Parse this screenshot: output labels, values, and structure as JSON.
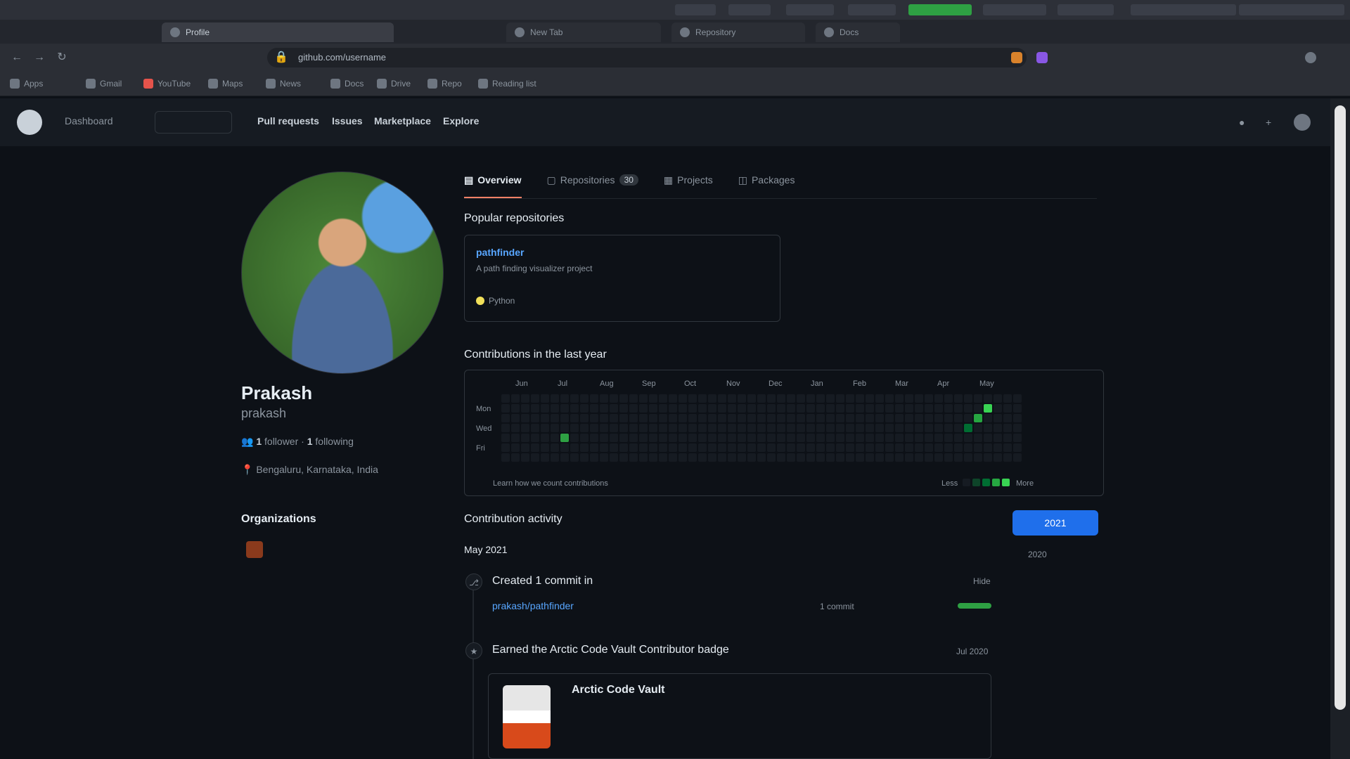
{
  "browser": {
    "tabs": [
      {
        "label": "Profile",
        "active": true
      },
      {
        "label": "New Tab",
        "active": false
      },
      {
        "label": "Repository",
        "active": false
      },
      {
        "label": "Docs",
        "active": false
      }
    ],
    "url": "github.com/username",
    "bookmarks": [
      "Apps",
      "Gmail",
      "YouTube",
      "Maps",
      "News",
      "Docs",
      "Drive",
      "Repo",
      "Reading list"
    ]
  },
  "header": {
    "user_label": "Dashboard",
    "nav": [
      "Pull requests",
      "Issues",
      "Marketplace",
      "Explore"
    ]
  },
  "profile": {
    "name": "Prakash",
    "login": "prakash",
    "followers_count": "1",
    "followers_label": "follower",
    "following_count": "1",
    "following_label": "following",
    "location": "Bengaluru, Karnataka, India",
    "organizations_title": "Organizations"
  },
  "tabs": [
    {
      "label": "Overview",
      "count": null,
      "active": true
    },
    {
      "label": "Repositories",
      "count": "30",
      "active": false
    },
    {
      "label": "Projects",
      "count": null,
      "active": false
    },
    {
      "label": "Packages",
      "count": null,
      "active": false
    }
  ],
  "pinned": {
    "title": "Popular repositories",
    "repo_name": "pathfinder",
    "repo_desc": "A path finding visualizer project",
    "language": "Python"
  },
  "contributions": {
    "title": "Contributions in the last year",
    "months": [
      "Jun",
      "Jul",
      "Aug",
      "Sep",
      "Oct",
      "Nov",
      "Dec",
      "Jan",
      "Feb",
      "Mar",
      "Apr",
      "May"
    ],
    "day_labels": [
      "Mon",
      "Wed",
      "Fri"
    ],
    "learn_link": "Learn how we count contributions",
    "less_label": "Less",
    "more_label": "More"
  },
  "activity": {
    "title": "Contribution activity",
    "year_button": "2021",
    "year_other": "2020",
    "month": "May 2021",
    "item1_text": "Created 1 commit in",
    "item1_repo": "prakash/pathfinder",
    "item1_commits": "1 commit",
    "item1_toggle": "Hide",
    "item2_text": "Earned the Arctic Code Vault Contributor badge",
    "item2_date": "Jul 2020",
    "badge_title": "Arctic Code Vault"
  },
  "colors": {
    "accent_blue": "#1f6feb",
    "contribution_green": "#2ea043",
    "tab_underline": "#f78166"
  }
}
